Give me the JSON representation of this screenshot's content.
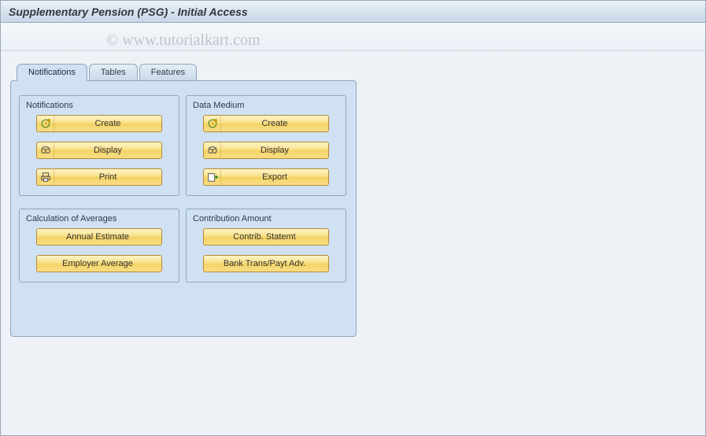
{
  "header": {
    "title": "Supplementary Pension (PSG) - Initial Access"
  },
  "watermark": "© www.tutorialkart.com",
  "tabs": [
    {
      "label": "Notifications",
      "active": true
    },
    {
      "label": "Tables",
      "active": false
    },
    {
      "label": "Features",
      "active": false
    }
  ],
  "groups": {
    "notifications": {
      "title": "Notifications",
      "buttons": {
        "create": "Create",
        "display": "Display",
        "print": "Print"
      }
    },
    "data_medium": {
      "title": "Data Medium",
      "buttons": {
        "create": "Create",
        "display": "Display",
        "export": "Export"
      }
    },
    "calc_avg": {
      "title": "Calculation of Averages",
      "buttons": {
        "annual_estimate": "Annual Estimate",
        "employer_average": "Employer Average"
      }
    },
    "contribution": {
      "title": "Contribution Amount",
      "buttons": {
        "statemt": "Contrib. Statemt",
        "bank_trans": "Bank Trans/Payt Adv."
      }
    }
  }
}
